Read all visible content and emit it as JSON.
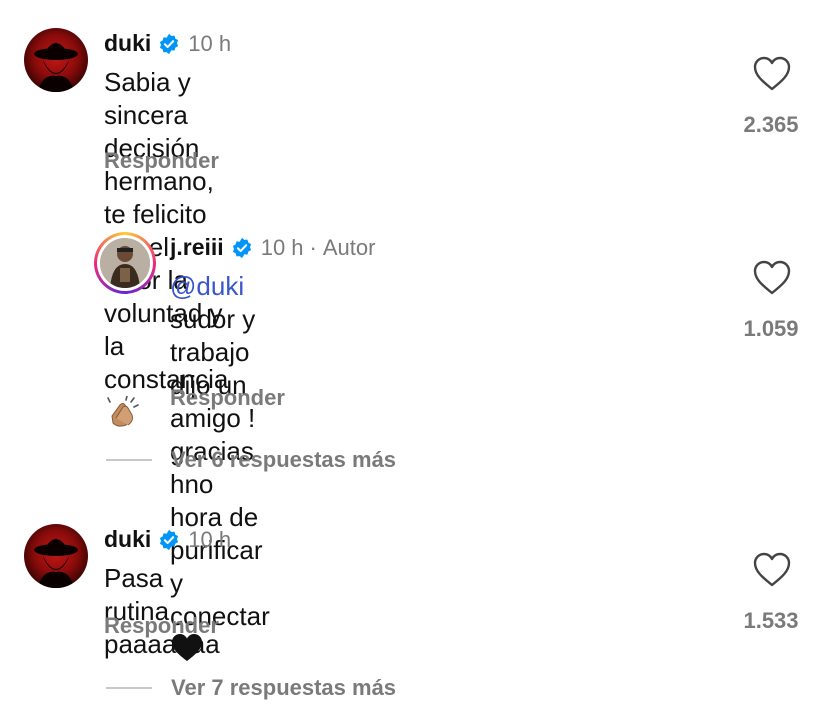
{
  "comments": [
    {
      "username": "duki",
      "time": "10 h",
      "text_lines": [
        "Sabia y sincera decisión hermano, te felicito",
        "por el valor la voluntad y la constancia"
      ],
      "emoji": "clapping-hands",
      "reply_label": "Responder",
      "like_count": "2.365"
    },
    {
      "username": "j.reiii",
      "time": "10 h",
      "separator": "·",
      "author_label": "Autor",
      "mention": "@duki",
      "text_rest": "sudor y trabajo dijo un amigo !",
      "text_line2": "gracias hno hora de purificar y conectar",
      "emoji": "black-heart",
      "reply_label": "Responder",
      "like_count": "1.059"
    },
    {
      "username": "duki",
      "time": "10 h",
      "text_lines": [
        "Pasa rutina paaaaaaa"
      ],
      "reply_label": "Responder",
      "like_count": "1.533"
    }
  ],
  "view_more": [
    "Ver 6 respuestas más",
    "Ver 7 respuestas más"
  ],
  "colors": {
    "verified": "#0095f6",
    "mention": "#3a56c9",
    "secondary_text": "#7a7a7a"
  },
  "icons": [
    "verified-badge-icon",
    "heart-outline-icon",
    "clapping-hands-emoji",
    "black-heart-emoji"
  ]
}
